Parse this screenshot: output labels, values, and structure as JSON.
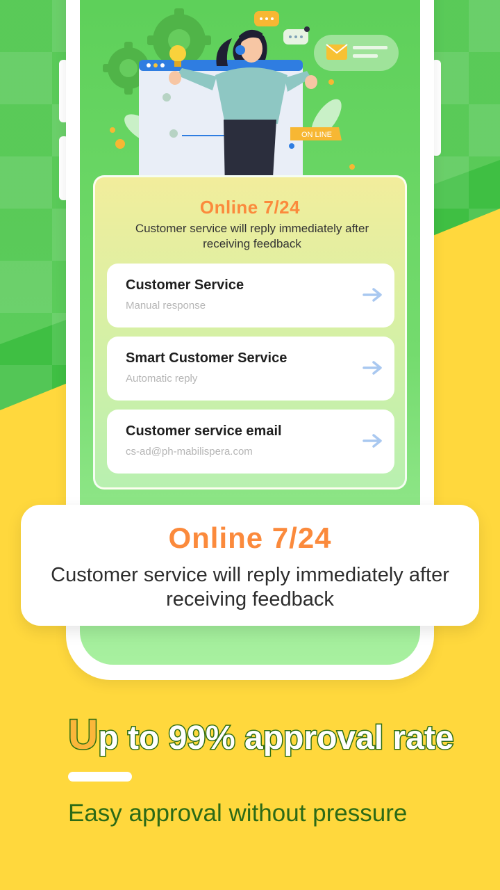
{
  "illustration": {
    "badge_text": "ON LINE"
  },
  "info_card": {
    "title": "Online 7/24",
    "subtitle": "Customer service will reply immediately after receiving feedback",
    "items": [
      {
        "name": "Customer Service",
        "description": "Manual response",
        "icon": "arrow-right-icon"
      },
      {
        "name": "Smart Customer Service",
        "description": "Automatic reply",
        "icon": "arrow-right-icon"
      },
      {
        "name": "Customer service email",
        "description": "cs-ad@ph-mabilispera.com",
        "icon": "arrow-right-icon"
      }
    ]
  },
  "banner": {
    "title": "Online 7/24",
    "subtitle": "Customer service will reply immediately after receiving feedback"
  },
  "promo": {
    "title_first_letter": "U",
    "title_rest": "p to 99% approval rate",
    "subtitle": "Easy approval without pressure"
  },
  "colors": {
    "accent_orange": "#fb8a3c",
    "green": "#3fbf43",
    "yellow": "#ffd83d",
    "dark_green_text": "#2c6a16"
  }
}
